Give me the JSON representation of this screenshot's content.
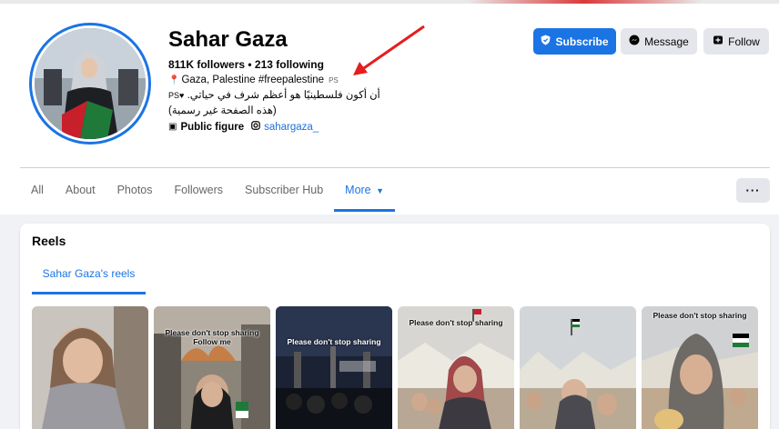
{
  "profile": {
    "name": "Sahar Gaza",
    "stats": "811K followers • 213 following",
    "bio_line1": "Gaza, Palestine #freepalestine",
    "bio_line1_suffix": "PS",
    "bio_line2": "أن أكون فلسطينيًا هو أعظم شرف في حياتي.",
    "bio_line2_suffix": "♥PS",
    "bio_line3": "(هذه الصفحة غير رسمية)",
    "category": "Public figure",
    "instagram": "sahargaza_",
    "icons": {
      "pin": "pin-icon",
      "category": "briefcase-icon",
      "instagram": "instagram-icon"
    }
  },
  "actions": {
    "subscribe": "Subscribe",
    "message": "Message",
    "follow": "Follow",
    "more": "···"
  },
  "tabs": [
    {
      "label": "All"
    },
    {
      "label": "Photos"
    },
    {
      "label": "About"
    },
    {
      "label": "Followers"
    },
    {
      "label": "Subscriber Hub"
    },
    {
      "label": "More",
      "active": true
    }
  ],
  "reels": {
    "title": "Reels",
    "tab_label": "Sahar Gaza's reels",
    "items": [
      {
        "caption": ""
      },
      {
        "caption": "Please don't stop sharing Follow me"
      },
      {
        "caption": "Please don't stop sharing"
      },
      {
        "caption": "Please don't stop sharing"
      },
      {
        "caption": ""
      },
      {
        "caption": "Please don't stop sharing"
      }
    ]
  },
  "colors": {
    "accent": "#1b74e4",
    "annotation_arrow": "#e41e1e"
  }
}
